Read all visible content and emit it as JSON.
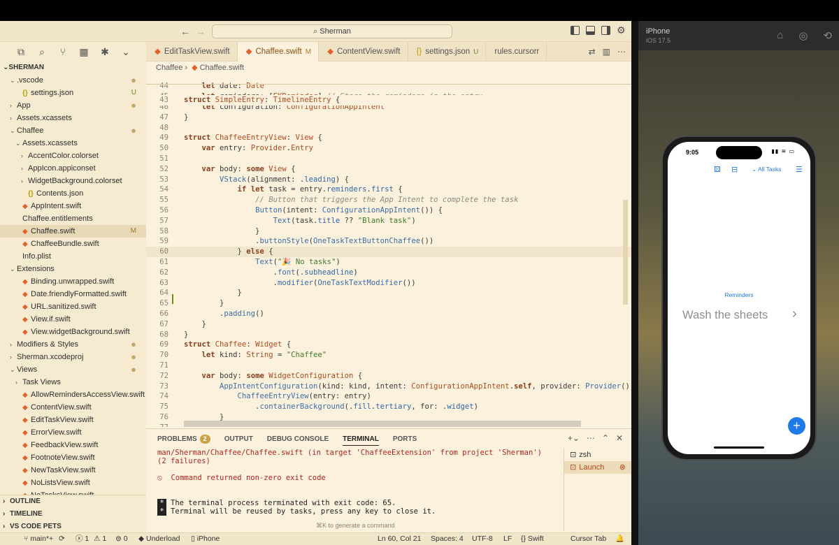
{
  "titlebar": {
    "back_label": "←",
    "forward_label": "→",
    "search_label": "⌕ Sherman"
  },
  "activity": [
    "⧉",
    "⌕",
    "⑂",
    "▦",
    "✱",
    "⌄"
  ],
  "sidebar": {
    "root": "SHERMAN",
    "items": [
      {
        "label": ".vscode",
        "indent": 1,
        "chev": "⌄",
        "icon": "",
        "badge": "●",
        "badge_type": "dot"
      },
      {
        "label": "settings.json",
        "indent": 2,
        "chev": "",
        "icon": "{}",
        "icon_type": "json",
        "badge": "U",
        "badge_type": "u"
      },
      {
        "label": "App",
        "indent": 1,
        "chev": "›",
        "icon": "",
        "badge": "●",
        "badge_type": "dot"
      },
      {
        "label": "Assets.xcassets",
        "indent": 1,
        "chev": "›",
        "icon": "",
        "badge": "",
        "badge_type": ""
      },
      {
        "label": "Chaffee",
        "indent": 1,
        "chev": "⌄",
        "icon": "",
        "badge": "●",
        "badge_type": "dot"
      },
      {
        "label": "Assets.xcassets",
        "indent": 2,
        "chev": "⌄",
        "icon": "",
        "badge": "",
        "badge_type": ""
      },
      {
        "label": "AccentColor.colorset",
        "indent": 3,
        "chev": "›",
        "icon": "",
        "badge": "",
        "badge_type": ""
      },
      {
        "label": "AppIcon.appiconset",
        "indent": 3,
        "chev": "›",
        "icon": "",
        "badge": "",
        "badge_type": ""
      },
      {
        "label": "WidgetBackground.colorset",
        "indent": 3,
        "chev": "›",
        "icon": "",
        "badge": "",
        "badge_type": ""
      },
      {
        "label": "Contents.json",
        "indent": 3,
        "chev": "",
        "icon": "{}",
        "icon_type": "json",
        "badge": "",
        "badge_type": ""
      },
      {
        "label": "AppIntent.swift",
        "indent": 2,
        "chev": "",
        "icon": "◆",
        "icon_type": "swift",
        "badge": "",
        "badge_type": ""
      },
      {
        "label": "Chaffee.entitlements",
        "indent": 2,
        "chev": "",
        "icon": "",
        "badge": "",
        "badge_type": ""
      },
      {
        "label": "Chaffee.swift",
        "indent": 2,
        "chev": "",
        "icon": "◆",
        "icon_type": "swift",
        "badge": "M",
        "badge_type": "m",
        "selected": true
      },
      {
        "label": "ChaffeeBundle.swift",
        "indent": 2,
        "chev": "",
        "icon": "◆",
        "icon_type": "swift",
        "badge": "",
        "badge_type": ""
      },
      {
        "label": "Info.plist",
        "indent": 2,
        "chev": "",
        "icon": "",
        "badge": "",
        "badge_type": ""
      },
      {
        "label": "Extensions",
        "indent": 1,
        "chev": "⌄",
        "icon": "",
        "badge": "",
        "badge_type": ""
      },
      {
        "label": "Binding.unwrapped.swift",
        "indent": 2,
        "chev": "",
        "icon": "◆",
        "icon_type": "swift",
        "badge": "",
        "badge_type": ""
      },
      {
        "label": "Date.friendlyFormatted.swift",
        "indent": 2,
        "chev": "",
        "icon": "◆",
        "icon_type": "swift",
        "badge": "",
        "badge_type": ""
      },
      {
        "label": "URL.sanitized.swift",
        "indent": 2,
        "chev": "",
        "icon": "◆",
        "icon_type": "swift",
        "badge": "",
        "badge_type": ""
      },
      {
        "label": "View.if.swift",
        "indent": 2,
        "chev": "",
        "icon": "◆",
        "icon_type": "swift",
        "badge": "",
        "badge_type": ""
      },
      {
        "label": "View.widgetBackground.swift",
        "indent": 2,
        "chev": "",
        "icon": "◆",
        "icon_type": "swift",
        "badge": "",
        "badge_type": ""
      },
      {
        "label": "Modifiers & Styles",
        "indent": 1,
        "chev": "›",
        "icon": "",
        "badge": "●",
        "badge_type": "dot"
      },
      {
        "label": "Sherman.xcodeproj",
        "indent": 1,
        "chev": "›",
        "icon": "",
        "badge": "●",
        "badge_type": "dot"
      },
      {
        "label": "Views",
        "indent": 1,
        "chev": "⌄",
        "icon": "",
        "badge": "●",
        "badge_type": "dot"
      },
      {
        "label": "Task Views",
        "indent": 2,
        "chev": "›",
        "icon": "",
        "badge": "",
        "badge_type": ""
      },
      {
        "label": "AllowRemindersAccessView.swift",
        "indent": 2,
        "chev": "",
        "icon": "◆",
        "icon_type": "swift",
        "badge": "",
        "badge_type": ""
      },
      {
        "label": "ContentView.swift",
        "indent": 2,
        "chev": "",
        "icon": "◆",
        "icon_type": "swift",
        "badge": "",
        "badge_type": ""
      },
      {
        "label": "EditTaskView.swift",
        "indent": 2,
        "chev": "",
        "icon": "◆",
        "icon_type": "swift",
        "badge": "",
        "badge_type": ""
      },
      {
        "label": "ErrorView.swift",
        "indent": 2,
        "chev": "",
        "icon": "◆",
        "icon_type": "swift",
        "badge": "",
        "badge_type": ""
      },
      {
        "label": "FeedbackView.swift",
        "indent": 2,
        "chev": "",
        "icon": "◆",
        "icon_type": "swift",
        "badge": "",
        "badge_type": ""
      },
      {
        "label": "FootnoteView.swift",
        "indent": 2,
        "chev": "",
        "icon": "◆",
        "icon_type": "swift",
        "badge": "",
        "badge_type": ""
      },
      {
        "label": "NewTaskView.swift",
        "indent": 2,
        "chev": "",
        "icon": "◆",
        "icon_type": "swift",
        "badge": "",
        "badge_type": ""
      },
      {
        "label": "NoListsView.swift",
        "indent": 2,
        "chev": "",
        "icon": "◆",
        "icon_type": "swift",
        "badge": "",
        "badge_type": ""
      },
      {
        "label": "NoTasksView.swift",
        "indent": 2,
        "chev": "",
        "icon": "◆",
        "icon_type": "swift",
        "badge": "",
        "badge_type": ""
      }
    ],
    "sections": [
      "OUTLINE",
      "TIMELINE",
      "VS CODE PETS"
    ]
  },
  "tabs": [
    {
      "label": "EditTaskView.swift",
      "icon": "◆",
      "suffix": "",
      "suffix_type": ""
    },
    {
      "label": "Chaffee.swift",
      "icon": "◆",
      "suffix": "M",
      "suffix_type": "mod",
      "active": true
    },
    {
      "label": "ContentView.swift",
      "icon": "◆",
      "suffix": "",
      "suffix_type": ""
    },
    {
      "label": "settings.json",
      "icon": "{}",
      "suffix": "U",
      "suffix_type": "u"
    },
    {
      "label": "rules.cursorr",
      "icon": "",
      "suffix": "",
      "suffix_type": ""
    }
  ],
  "tab_actions": [
    "⇄",
    "▥",
    "⋯"
  ],
  "breadcrumb": {
    "folder": "Chaffee",
    "sep": "›",
    "file": "Chaffee.swift"
  },
  "editor": {
    "sticky": {
      "n": "43",
      "html": "<span class='kw'>struct</span> <span class='ty'>SimpleEntry</span>: <span class='ty'>TimelineEntry</span> {"
    },
    "lines": [
      {
        "n": "44",
        "html": "    <span class='kw'>let</span> date: <span class='ty'>Date</span>"
      },
      {
        "n": "45",
        "html": "    <span class='kw'>let</span> reminders: [<span class='ty'>EKReminder</span>] <span class='cm'>// Store the reminders in the entry</span>"
      },
      {
        "n": "46",
        "html": "    <span class='kw'>let</span> configuration: <span class='ty'>ConfigurationAppIntent</span>"
      },
      {
        "n": "47",
        "html": "}"
      },
      {
        "n": "48",
        "html": ""
      },
      {
        "n": "49",
        "html": "<span class='kw'>struct</span> <span class='ty'>ChaffeeEntryView</span>: <span class='ty'>View</span> {"
      },
      {
        "n": "50",
        "html": "    <span class='kw'>var</span> entry: <span class='ty'>Provider</span>.<span class='ty'>Entry</span>"
      },
      {
        "n": "51",
        "html": ""
      },
      {
        "n": "52",
        "html": "    <span class='kw'>var</span> body: <span class='kw'>some</span> <span class='ty'>View</span> {"
      },
      {
        "n": "53",
        "html": "        <span class='fn'>VStack</span>(alignment: .<span class='pl'>leading</span>) {"
      },
      {
        "n": "54",
        "html": "            <span class='kw'>if</span> <span class='kw'>let</span> task = entry.<span class='pl'>reminders</span>.<span class='pl'>first</span> {"
      },
      {
        "n": "55",
        "html": "                <span class='cm'>// Button that triggers the App Intent to complete the task</span>"
      },
      {
        "n": "56",
        "html": "                <span class='fn'>Button</span>(intent: <span class='fn'>ConfigurationAppIntent</span>()) {"
      },
      {
        "n": "57",
        "html": "                    <span class='fn'>Text</span>(task.<span class='pl'>title</span> ?? <span class='st'>\"Blank task\"</span>)"
      },
      {
        "n": "58",
        "html": "                }"
      },
      {
        "n": "59",
        "html": "                .<span class='fn'>buttonStyle</span>(<span class='fn'>OneTaskTextButtonChaffee</span>())"
      },
      {
        "n": "60",
        "html": "            } <span class='kw'>else</span> {",
        "current": true
      },
      {
        "n": "61",
        "html": "                <span class='fn'>Text</span>(<span class='st'>\"🎉 No tasks\"</span>)"
      },
      {
        "n": "62",
        "html": "                    .<span class='fn'>font</span>(.<span class='pl'>subheadline</span>)"
      },
      {
        "n": "63",
        "html": "                    .<span class='fn'>modifier</span>(<span class='fn'>OneTaskTextModifier</span>())"
      },
      {
        "n": "64",
        "html": "            }"
      },
      {
        "n": "65",
        "html": "        }"
      },
      {
        "n": "66",
        "html": "        .<span class='fn'>padding</span>()"
      },
      {
        "n": "67",
        "html": "    }"
      },
      {
        "n": "68",
        "html": "}"
      },
      {
        "n": "69",
        "html": "<span class='kw'>struct</span> <span class='ty'>Chaffee</span>: <span class='ty'>Widget</span> {"
      },
      {
        "n": "70",
        "html": "    <span class='kw'>let</span> kind: <span class='ty'>String</span> = <span class='st'>\"Chaffee\"</span>"
      },
      {
        "n": "71",
        "html": ""
      },
      {
        "n": "72",
        "html": "    <span class='kw'>var</span> body: <span class='kw'>some</span> <span class='ty'>WidgetConfiguration</span> {"
      },
      {
        "n": "73",
        "html": "        <span class='fn'>AppIntentConfiguration</span>(kind: kind, intent: <span class='ty'>ConfigurationAppIntent</span>.<span class='kw'>self</span>, provider: <span class='fn'>Provider</span>()) { entry"
      },
      {
        "n": "74",
        "html": "            <span class='fn'>ChaffeeEntryView</span>(entry: entry)"
      },
      {
        "n": "75",
        "html": "                .<span class='fn'>containerBackground</span>(.<span class='pl'>fill</span>.<span class='pl'>tertiary</span>, for: .<span class='pl'>widget</span>)"
      },
      {
        "n": "76",
        "html": "        }"
      },
      {
        "n": "77",
        "html": "    }"
      }
    ]
  },
  "panel": {
    "tabs": [
      "PROBLEMS",
      "OUTPUT",
      "DEBUG CONSOLE",
      "TERMINAL",
      "PORTS"
    ],
    "active_tab": "TERMINAL",
    "problems_count": "2",
    "actions": [
      "+⌄",
      "⋯",
      "⌃",
      "✕"
    ],
    "terminal_lines": [
      {
        "text": "man/Sherman/Chaffee/Chaffee.swift (in target 'ChaffeeExtension' from project 'Sherman')",
        "type": "err"
      },
      {
        "text": "(2 failures)",
        "type": "err"
      },
      {
        "text": "",
        "type": "norm"
      },
      {
        "text": "⦸  Command returned non-zero exit code",
        "type": "err"
      },
      {
        "text": "",
        "type": "norm"
      },
      {
        "text": "",
        "type": "norm"
      },
      {
        "text": "The terminal process terminated with exit code: 65.",
        "type": "star"
      },
      {
        "text": "Terminal will be reused by tasks, press any key to close it.",
        "type": "star"
      }
    ],
    "hint": "⌘K to generate a command",
    "terminals": [
      {
        "label": "zsh",
        "icon": "⊡"
      },
      {
        "label": "Launch",
        "icon": "⊡",
        "active": true,
        "close": "⊗"
      }
    ]
  },
  "statusbar": {
    "branch": "⑂ main*+",
    "sync": "⟳",
    "errors": "ⓧ 1",
    "warnings": "⚠ 1",
    "ports": "⊚ 0",
    "underload": "◆ Underload",
    "device": "▯ iPhone",
    "position": "Ln 60, Col 21",
    "spaces": "Spaces: 4",
    "encoding": "UTF-8",
    "eol": "LF",
    "lang": "{} Swift",
    "tab": "Cursor Tab",
    "bell": "🔔"
  },
  "simulator": {
    "name": "iPhone",
    "os": "iOS 17.5",
    "icons": [
      "⌂",
      "◎",
      "⟲"
    ],
    "phone": {
      "time": "9:05",
      "status_icons": "▮▮ ≋ ▭",
      "toolbar_icons": [
        "⚄",
        "⊟"
      ],
      "all_tasks": "⌄ All Tasks",
      "list_icon": "☰",
      "reminders_label": "Reminders",
      "task_title": "Wash the sheets",
      "chevron": "›",
      "add": "+"
    }
  },
  "colors": {
    "editor_bg": "#fbf1dd",
    "accent_blue": "#1e7ae6",
    "swift_orange": "#e5612b",
    "error_red": "#b22323"
  }
}
